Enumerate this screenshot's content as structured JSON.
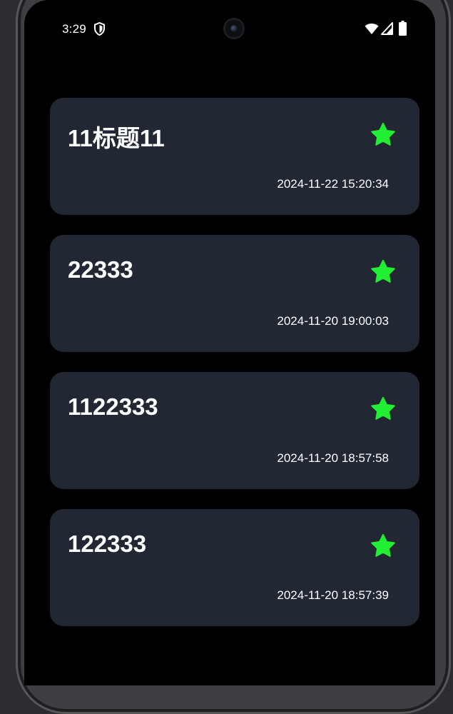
{
  "status_bar": {
    "time": "3:29"
  },
  "notes": [
    {
      "title": "11标题11",
      "timestamp": "2024-11-22 15:20:34",
      "starred": true
    },
    {
      "title": "22333",
      "timestamp": "2024-11-20 19:00:03",
      "starred": true
    },
    {
      "title": "1122333",
      "timestamp": "2024-11-20 18:57:58",
      "starred": true
    },
    {
      "title": "122333",
      "timestamp": "2024-11-20 18:57:39",
      "starred": true
    }
  ],
  "colors": {
    "background": "#000000",
    "card": "#212833",
    "star": "#22ee33",
    "text": "#ffffff"
  },
  "icons": {
    "status": [
      "shield-icon",
      "wifi-icon",
      "signal-icon",
      "battery-icon"
    ],
    "card_action": "star-icon"
  }
}
